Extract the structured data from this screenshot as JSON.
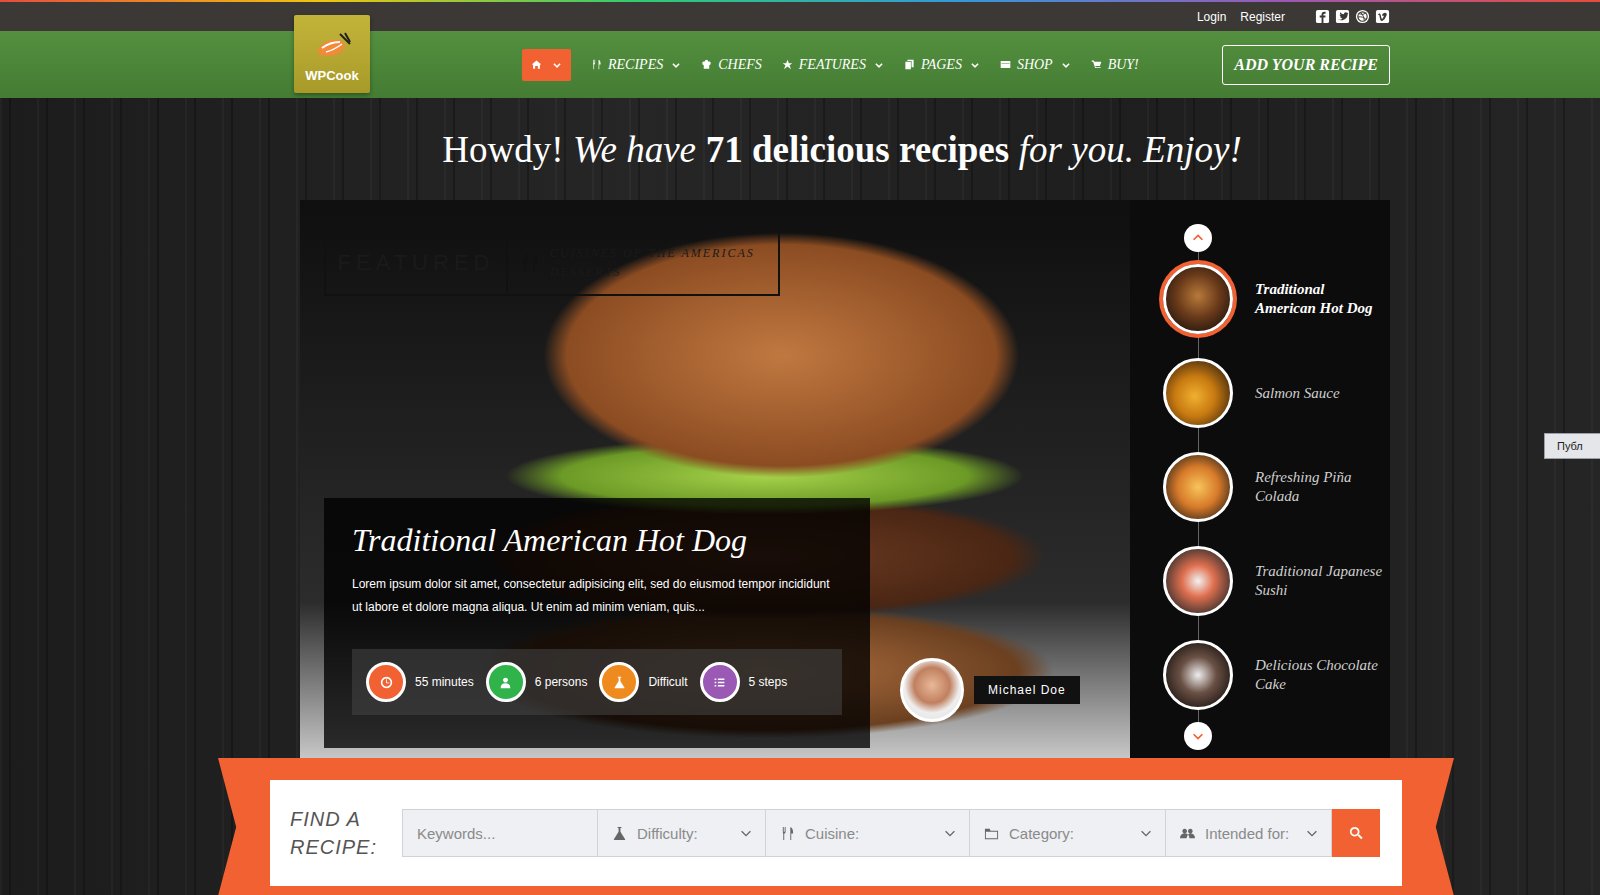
{
  "top_bar": {
    "links": [
      "Login",
      "Register"
    ]
  },
  "logo": {
    "text": "WPCook"
  },
  "nav": [
    {
      "label": "",
      "selected": true,
      "has_menu": true
    },
    {
      "label": "RECIPES",
      "selected": false,
      "has_menu": true
    },
    {
      "label": "CHEFS",
      "selected": false,
      "has_menu": false
    },
    {
      "label": "FEATURES",
      "selected": false,
      "has_menu": true
    },
    {
      "label": "PAGES",
      "selected": false,
      "has_menu": true
    },
    {
      "label": "SHOP",
      "selected": false,
      "has_menu": true
    },
    {
      "label": "BUY!",
      "selected": false,
      "has_menu": false
    }
  ],
  "cta": "ADD YOUR RECIPE",
  "headline": [
    {
      "text": "Howdy!",
      "kind": "plain"
    },
    {
      "text": "We have",
      "kind": "italic"
    },
    {
      "text": "71 delicious recipes",
      "kind": "bold"
    },
    {
      "text": "for you. Enjoy!",
      "kind": "italic"
    }
  ],
  "featured": {
    "badge": "FEATURED",
    "categories": [
      "CUISINES OF THE AMERICAS",
      "DESSERTS"
    ]
  },
  "recipe": {
    "title": "Traditional American Hot Dog",
    "excerpt": "Lorem ipsum dolor sit amet, consectetur adipisicing elit, sed do eiusmod tempor incididunt ut labore et dolore magna aliqua. Ut enim ad minim veniam, quis...",
    "stats": [
      {
        "value": "55 minutes",
        "color": "#f26131"
      },
      {
        "value": "6 persons",
        "color": "#2fb34a"
      },
      {
        "value": "Difficult",
        "color": "#ef8a1f"
      },
      {
        "value": "5 steps",
        "color": "#9b59b6"
      }
    ],
    "author": "Michael Doe"
  },
  "slides": [
    {
      "title": "Traditional American Hot Dog",
      "selected": true
    },
    {
      "title": "Salmon Sauce",
      "selected": false
    },
    {
      "title": "Refreshing Piña Colada",
      "selected": false
    },
    {
      "title": "Traditional Japanese Sushi",
      "selected": false
    },
    {
      "title": "Delicious Chocolate Cake",
      "selected": false
    }
  ],
  "search": {
    "label": "FIND A RECIPE:",
    "placeholder": "Keywords...",
    "selects": [
      "Difficulty:",
      "Cuisine:",
      "Category:",
      "Intended for:"
    ]
  },
  "side_tab": "Публ"
}
